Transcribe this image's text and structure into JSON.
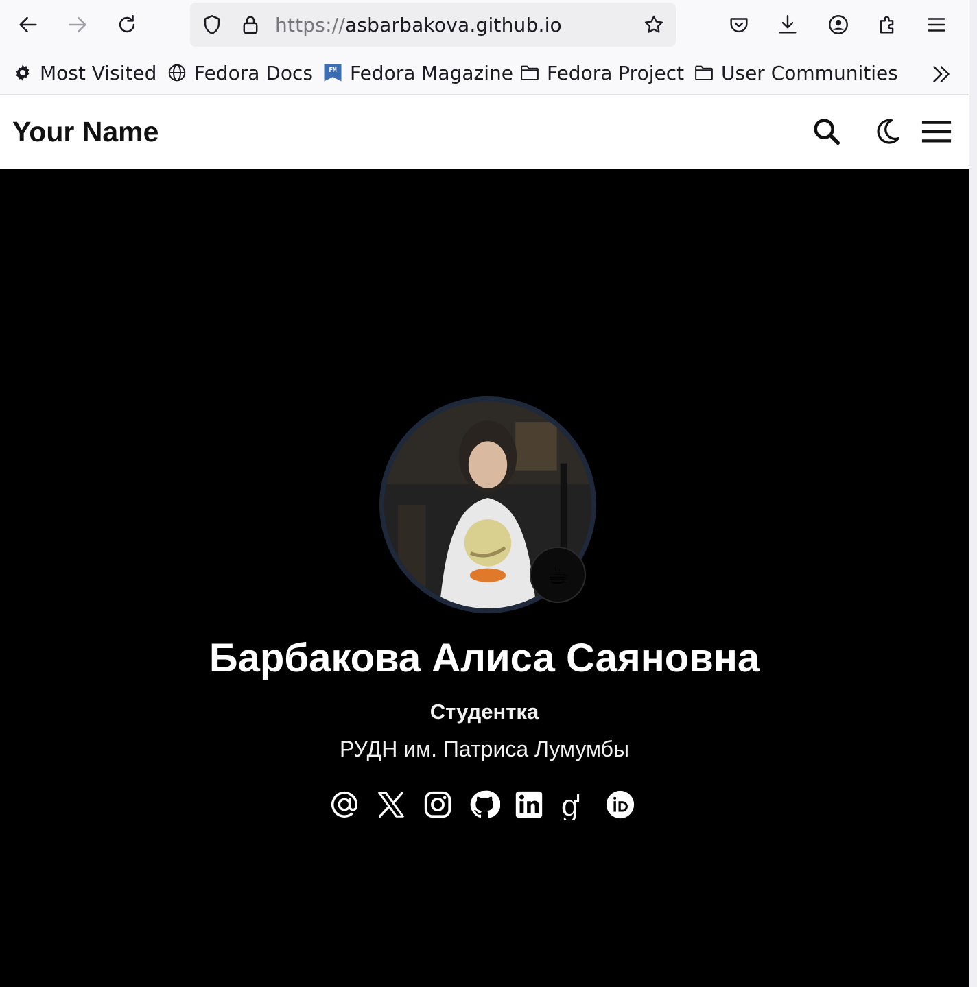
{
  "browser": {
    "url_protocol": "https://",
    "url_host": "asbarbakova.github.io"
  },
  "bookmarks": [
    {
      "label": "Most Visited",
      "icon": "gear-icon"
    },
    {
      "label": "Fedora Docs",
      "icon": "globe-icon"
    },
    {
      "label": "Fedora Magazine",
      "icon": "fedora-magazine-icon"
    },
    {
      "label": "Fedora Project",
      "icon": "folder-icon"
    },
    {
      "label": "User Communities",
      "icon": "folder-icon"
    }
  ],
  "header": {
    "site_title": "Your Name"
  },
  "profile": {
    "name": "Барбакова Алиса Саяновна",
    "role": "Студентка",
    "organization": "РУДН им. Патриса Лумумбы",
    "status_emoji": "☕"
  },
  "social_links": [
    "email",
    "x",
    "instagram",
    "github",
    "linkedin",
    "google-scholar",
    "orcid"
  ]
}
